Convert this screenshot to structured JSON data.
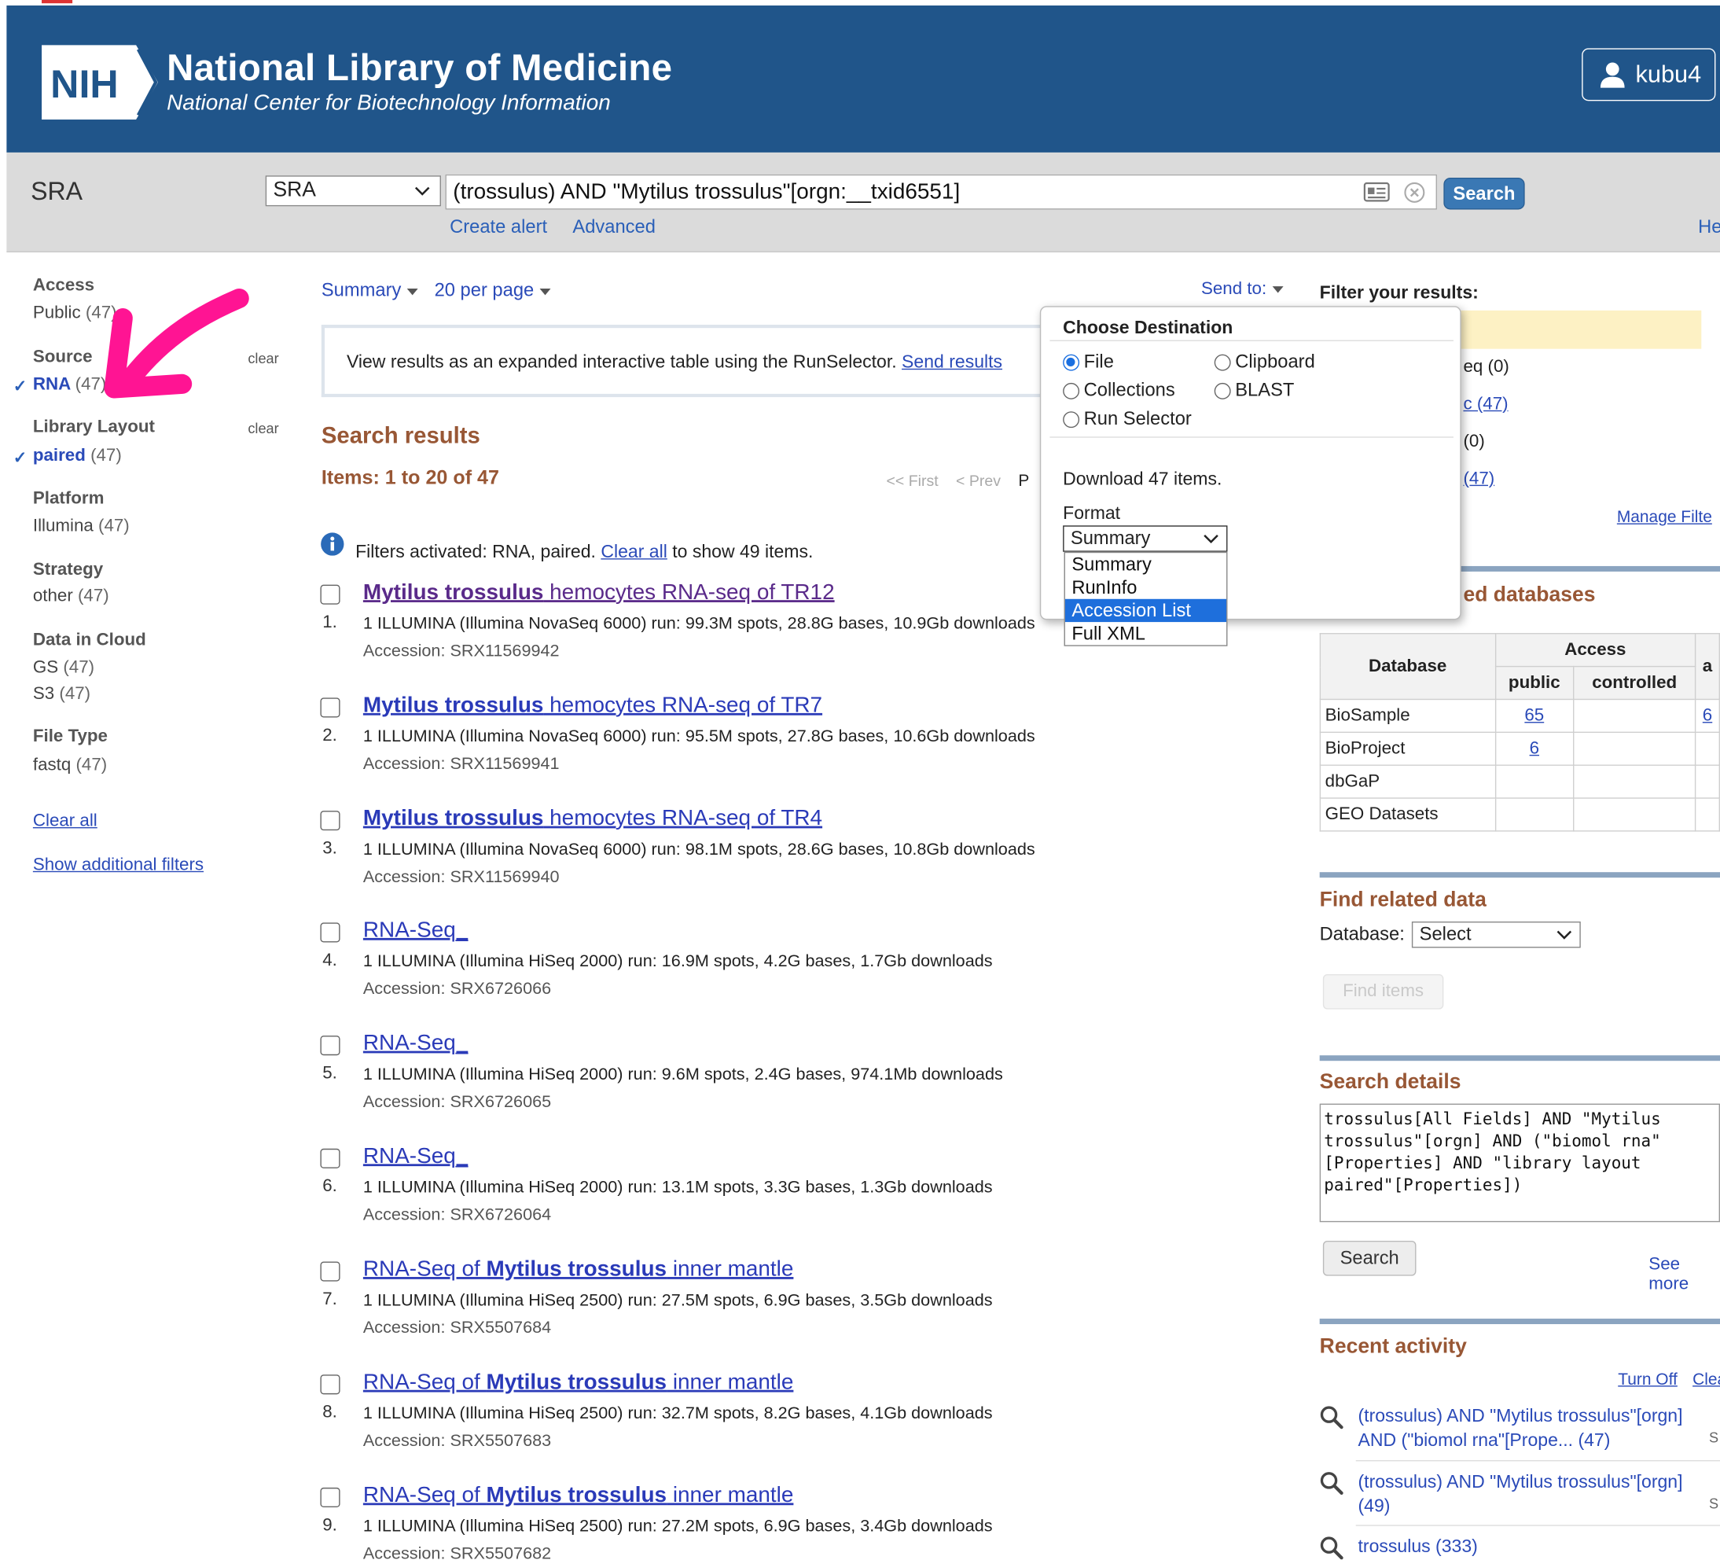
{
  "header": {
    "logo_text": "NIH",
    "title": "National Library of Medicine",
    "subtitle": "National Center for Biotechnology Information",
    "username": "kubu4",
    "brand_color": "#20558a"
  },
  "searchbar": {
    "db_label": "SRA",
    "db_select": "SRA",
    "term": "(trossulus) AND \"Mytilus trossulus\"[orgn:__txid6551]",
    "search_label": "Search",
    "create_alert": "Create alert",
    "advanced": "Advanced",
    "help": "He"
  },
  "filters": {
    "access": {
      "title": "Access",
      "item": "Public",
      "count": "(47)"
    },
    "source": {
      "title": "Source",
      "clear": "clear",
      "item": "RNA",
      "count": "(47)"
    },
    "layout": {
      "title": "Library Layout",
      "clear": "clear",
      "item": "paired",
      "count": "(47)"
    },
    "platform": {
      "title": "Platform",
      "item": "Illumina",
      "count": "(47)"
    },
    "strategy": {
      "title": "Strategy",
      "item": "other",
      "count": "(47)"
    },
    "cloud": {
      "title": "Data in Cloud",
      "item1": "GS",
      "count1": "(47)",
      "item2": "S3",
      "count2": "(47)"
    },
    "filetype": {
      "title": "File Type",
      "item": "fastq",
      "count": "(47)"
    },
    "clear_all": "Clear all",
    "show_additional": "Show additional filters",
    "check_glyph": "✓"
  },
  "center": {
    "summary": "Summary",
    "per_page": "20 per page",
    "send_to": "Send to:",
    "runsel_text": "View results as an expanded interactive table using the RunSelector.",
    "runsel_link": "Send results",
    "sr_title": "Search results",
    "items_count": "Items: 1 to 20 of 47",
    "pager_first": "<< First",
    "pager_prev": "< Prev",
    "pager_p": "P",
    "filters_pre": "Filters activated: RNA, paired.",
    "filters_link": "Clear all",
    "filters_post": "to show 49 items."
  },
  "results": [
    {
      "num": "1.",
      "t1": "Mytilus trossulus",
      "t2": " hemocytes RNA-seq of TR12",
      "t3": "",
      "t4": "",
      "desc": "1 ILLUMINA (Illumina NovaSeq 6000) run: 99.3M spots, 28.8G bases, 10.9Gb downloads",
      "acc": "Accession: SRX11569942"
    },
    {
      "num": "2.",
      "t1": "Mytilus trossulus",
      "t2": " hemocytes RNA-seq of TR7",
      "t3": "",
      "t4": "",
      "desc": "1 ILLUMINA (Illumina NovaSeq 6000) run: 95.5M spots, 27.8G bases, 10.6Gb downloads",
      "acc": "Accession: SRX11569941"
    },
    {
      "num": "3.",
      "t1": "Mytilus trossulus",
      "t2": " hemocytes RNA-seq of TR4",
      "t3": "",
      "t4": "",
      "desc": "1 ILLUMINA (Illumina NovaSeq 6000) run: 98.1M spots, 28.6G bases, 10.8Gb downloads",
      "acc": "Accession: SRX11569940"
    },
    {
      "num": "4.",
      "t1": "",
      "t2": "",
      "t3": "RNA-Seq_",
      "t4": "",
      "desc": "1 ILLUMINA (Illumina HiSeq 2000) run: 16.9M spots, 4.2G bases, 1.7Gb downloads",
      "acc": "Accession: SRX6726066"
    },
    {
      "num": "5.",
      "t1": "",
      "t2": "",
      "t3": "RNA-Seq_",
      "t4": "",
      "desc": "1 ILLUMINA (Illumina HiSeq 2000) run: 9.6M spots, 2.4G bases, 974.1Mb downloads",
      "acc": "Accession: SRX6726065"
    },
    {
      "num": "6.",
      "t1": "",
      "t2": "",
      "t3": "RNA-Seq_",
      "t4": "",
      "desc": "1 ILLUMINA (Illumina HiSeq 2000) run: 13.1M spots, 3.3G bases, 1.3Gb downloads",
      "acc": "Accession: SRX6726064"
    },
    {
      "num": "7.",
      "t1": "Mytilus trossulus",
      "t2": " inner mantle",
      "t3": "RNA-Seq of ",
      "t4": "",
      "desc": "1 ILLUMINA (Illumina HiSeq 2500) run: 27.5M spots, 6.9G bases, 3.5Gb downloads",
      "acc": "Accession: SRX5507684"
    },
    {
      "num": "8.",
      "t1": "Mytilus trossulus",
      "t2": " inner mantle",
      "t3": "RNA-Seq of ",
      "t4": "",
      "desc": "1 ILLUMINA (Illumina HiSeq 2500) run: 32.7M spots, 8.2G bases, 4.1Gb downloads",
      "acc": "Accession: SRX5507683"
    },
    {
      "num": "9.",
      "t1": "Mytilus trossulus",
      "t2": " inner mantle",
      "t3": "RNA-Seq of ",
      "t4": "",
      "desc": "1 ILLUMINA (Illumina HiSeq 2500) run: 27.2M spots, 6.9G bases, 3.4Gb downloads",
      "acc": "Accession: SRX5507682"
    }
  ],
  "right": {
    "filter_your": "Filter your results:",
    "frag1": "eq (0)",
    "frag2": "c (47)",
    "frag3": "(0)",
    "frag4": "(47)",
    "manage_filters": "Manage Filte",
    "related_title": "ed databases",
    "table": {
      "h_database": "Database",
      "h_access": "Access",
      "h_a": "a",
      "h_public": "public",
      "h_controlled": "controlled",
      "rows": [
        {
          "db": "BioSample",
          "public": "65",
          "extra": "6"
        },
        {
          "db": "BioProject",
          "public": "6",
          "extra": ""
        },
        {
          "db": "dbGaP",
          "public": "",
          "extra": ""
        },
        {
          "db": "GEO Datasets",
          "public": "",
          "extra": ""
        }
      ]
    },
    "find_related": "Find related data",
    "frd_db_label": "Database:",
    "frd_select": "Select",
    "find_items": "Find items",
    "details_title": "Search details",
    "details_text": "trossulus[All Fields] AND \"Mytilus trossulus\"[orgn] AND (\"biomol rna\"[Properties] AND \"library layout paired\"[Properties])",
    "details_search": "Search",
    "see_more": "See more",
    "recent_title": "Recent activity",
    "turn_off": "Turn Off",
    "clear": "Clea",
    "recent": [
      {
        "text": "(trossulus) AND \"Mytilus trossulus\"[orgn] AND (\"biomol rna\"[Prope... (47)",
        "s": "S"
      },
      {
        "text": "(trossulus) AND \"Mytilus trossulus\"[orgn] (49)",
        "s": "S"
      },
      {
        "text": "trossulus (333)",
        "s": ""
      }
    ]
  },
  "popup": {
    "title": "Choose Destination",
    "file": "File",
    "clipboard": "Clipboard",
    "collections": "Collections",
    "blast": "BLAST",
    "run_selector": "Run Selector",
    "download": "Download 47 items.",
    "format_label": "Format",
    "format_value": "Summary",
    "options": [
      "Summary",
      "RunInfo",
      "Accession List",
      "Full XML"
    ],
    "selected_option": "Accession List"
  },
  "colors": {
    "accent_magenta": "#ff1493",
    "section_brown": "#985735",
    "link_blue": "#2a4ab8"
  },
  "icons": [
    "user-icon",
    "chevron-down-icon",
    "id-card-icon",
    "clear-circle-icon",
    "info-icon",
    "checkmark-icon",
    "magnifier-icon",
    "annotation-arrow"
  ]
}
